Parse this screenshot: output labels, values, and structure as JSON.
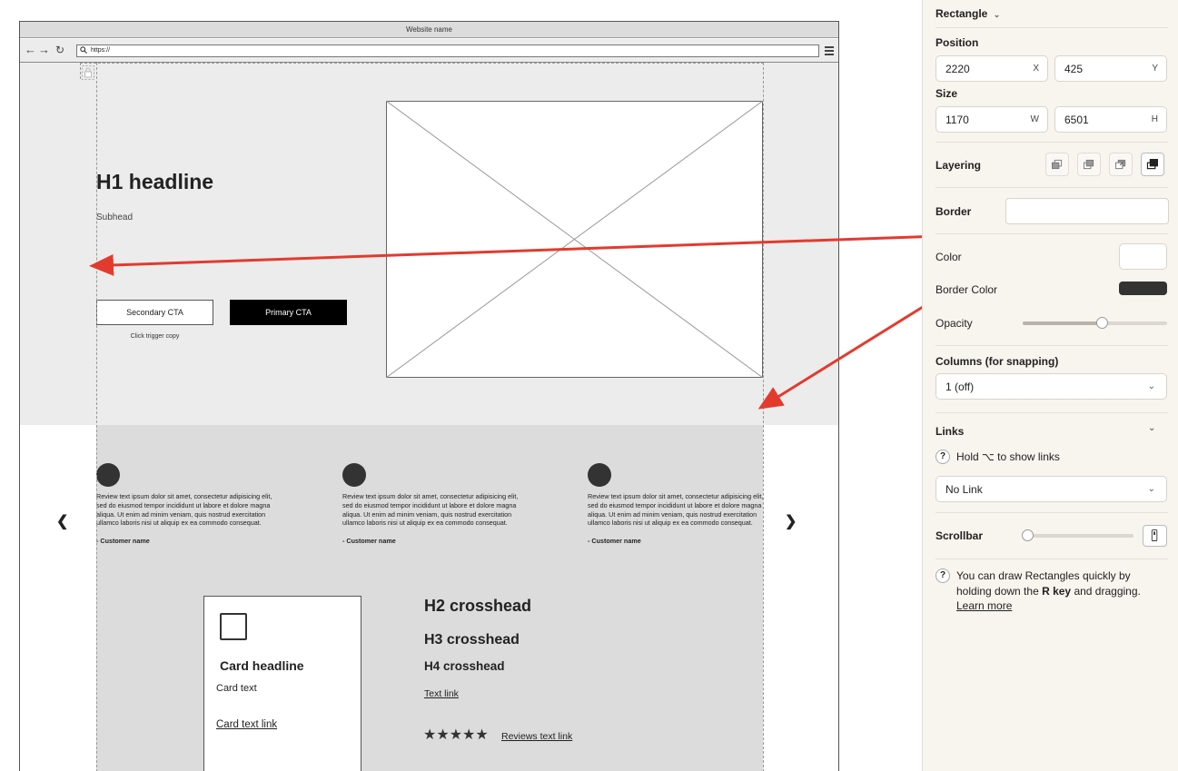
{
  "browser": {
    "title": "Website name",
    "url": "https://"
  },
  "hero": {
    "h1": "H1 headline",
    "subhead": "Subhead",
    "secondary_cta": "Secondary CTA",
    "primary_cta": "Primary CTA",
    "trigger_copy": "Click trigger copy"
  },
  "reviews": [
    {
      "text": "Review text ipsum dolor sit amet, consectetur adipisicing elit, sed do eiusmod tempor incididunt ut labore et dolore magna aliqua. Ut enim ad minim veniam, quis nostrud exercitation ullamco laboris nisi ut aliquip ex ea commodo consequat.",
      "name": "- Customer name"
    },
    {
      "text": "Review text ipsum dolor sit amet, consectetur adipisicing elit, sed do eiusmod tempor incididunt ut labore et dolore magna aliqua. Ut enim ad minim veniam, quis nostrud exercitation ullamco laboris nisi ut aliquip ex ea commodo consequat.",
      "name": "- Customer name"
    },
    {
      "text": "Review text ipsum dolor sit amet, consectetur adipisicing elit, sed do eiusmod tempor incididunt ut labore et dolore magna aliqua. Ut enim ad minim veniam, quis nostrud exercitation ullamco laboris nisi ut aliquip ex ea commodo consequat.",
      "name": "- Customer name"
    }
  ],
  "card": {
    "headline": "Card headline",
    "text": "Card text",
    "link": "Card text link"
  },
  "content": {
    "h2": "H2 crosshead",
    "h3": "H3 crosshead",
    "h4": "H4 crosshead",
    "text_link": "Text link",
    "stars": "★★★★★",
    "reviews_link": "Reviews text link"
  },
  "panel": {
    "element_type": "Rectangle",
    "position_label": "Position",
    "x_value": "2220",
    "x_unit": "X",
    "y_value": "425",
    "y_unit": "Y",
    "size_label": "Size",
    "w_value": "1170",
    "w_unit": "W",
    "h_value": "6501",
    "h_unit": "H",
    "layering_label": "Layering",
    "border_label": "Border",
    "color_label": "Color",
    "border_color_label": "Border Color",
    "opacity_label": "Opacity",
    "opacity_value": 0.55,
    "columns_label": "Columns (for snapping)",
    "columns_value": "1 (off)",
    "links_label": "Links",
    "links_help": "Hold ⌥ to show links",
    "link_value": "No Link",
    "scrollbar_label": "Scrollbar",
    "tip_text_1": "You can draw Rectangles quickly by holding down the ",
    "tip_key": "R key",
    "tip_text_2": " and dragging.",
    "learn_more": "Learn more",
    "help_mark": "?"
  },
  "colors": {
    "fill_color": "#ffffff",
    "border_color": "#333333",
    "arrow": "#e23b2e",
    "panel_bg": "#f8f4ee"
  }
}
